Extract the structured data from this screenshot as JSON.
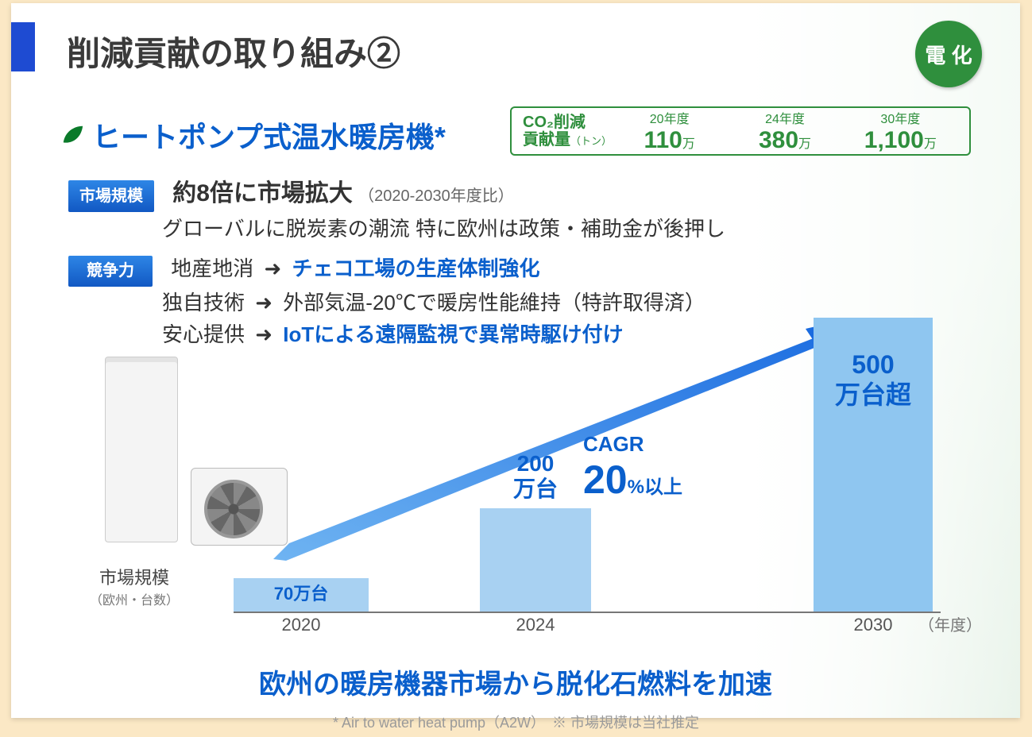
{
  "header": {
    "title": "削減貢献の取り組み②",
    "badge": "電 化"
  },
  "subheading": {
    "title": "ヒートポンプ式温水暖房機*"
  },
  "co2": {
    "label_line1": "CO₂削減",
    "label_line2": "貢献量",
    "label_unit": "（トン）",
    "cells": [
      {
        "year": "20年度",
        "value": "110",
        "unit": "万"
      },
      {
        "year": "24年度",
        "value": "380",
        "unit": "万"
      },
      {
        "year": "30年度",
        "value": "1,100",
        "unit": "万"
      }
    ]
  },
  "market": {
    "tag": "市場規模",
    "line1_bold": "約8倍に市場拡大",
    "line1_note": "（2020-2030年度比）",
    "line2": "グローバルに脱炭素の潮流 特に欧州は政策・補助金が後押し"
  },
  "compete": {
    "tag": "競争力",
    "rows": [
      {
        "a": "地産地消",
        "b": "チェコ工場の生産体制強化",
        "hl": true
      },
      {
        "a": "独自技術",
        "b": "外部気温-20℃で暖房性能維持（特許取得済）",
        "hl": false
      },
      {
        "a": "安心提供",
        "b": "IoTによる遠隔監視で異常時駆け付け",
        "hl": true
      }
    ]
  },
  "market_label": {
    "t": "市場規模",
    "s": "（欧州・台数）"
  },
  "cagr": {
    "l1": "CAGR",
    "big": "20",
    "suf": "%以上"
  },
  "chart_data": {
    "type": "bar",
    "title": "欧州 ヒートポンプ式温水暖房機 市場規模（台数）",
    "xlabel": "年度",
    "ylabel": "万台",
    "categories": [
      "2020",
      "2024",
      "2030"
    ],
    "values": [
      70,
      200,
      500
    ],
    "value_labels": [
      "70万台",
      "200\n万台",
      "500\n万台超"
    ],
    "ylim": [
      0,
      550
    ],
    "annotation": "CAGR 20%以上"
  },
  "x_unit": "（年度）",
  "bottom": "欧州の暖房機器市場から脱化石燃料を加速",
  "footnote": "* Air to water heat pump（A2W）　※ 市場規模は当社推定"
}
